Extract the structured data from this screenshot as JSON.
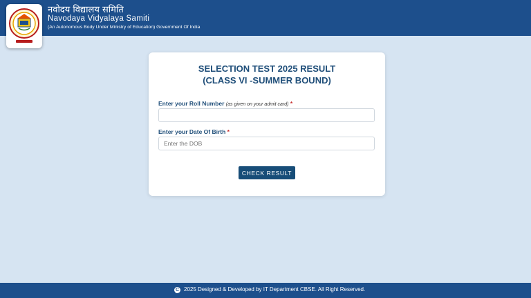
{
  "header": {
    "hindi_name": "नवोदय विद्यालय समिति",
    "name": "Navodaya Vidyalaya Samiti",
    "subtitle": "(An Autonomous Body Under Ministry of Education) Government Of India",
    "logo_icon": "nvs-emblem-icon"
  },
  "result_card": {
    "title_line1": "SELECTION TEST 2025 RESULT",
    "title_line2": "(CLASS VI -SUMMER BOUND)",
    "roll_label": "Enter your Roll Number",
    "roll_note": "(as given on your admit card)",
    "roll_value": "",
    "dob_label": "Enter your Date Of Birth",
    "dob_placeholder": "Enter the DOB",
    "dob_value": "",
    "required_mark": "*",
    "submit_label": "CHECK RESULT"
  },
  "footer": {
    "copyright_icon": "copyright-icon",
    "text": "2025 Designed & Developed by IT Department CBSE. All Right Reserved."
  },
  "colors": {
    "header_bg": "#1d4f8c",
    "page_bg": "#d6e4f2",
    "title": "#1f4e79",
    "button_bg": "#174d78",
    "required": "#c62828"
  }
}
